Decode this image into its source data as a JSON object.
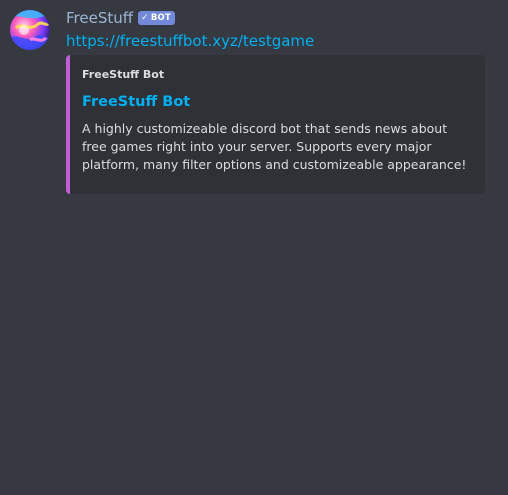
{
  "message": {
    "author": {
      "name": "FreeStuff",
      "badge": {
        "check": "✓",
        "label": "BOT",
        "color": "#7289da"
      },
      "avatar_icon": "gradient-blob-avatar"
    },
    "link_text": "https://freestuffbot.xyz/testgame",
    "embed": {
      "accent_color": "#c25ed5",
      "author": "FreeStuff Bot",
      "title": "FreeStuff Bot",
      "description": "A highly customizeable discord bot that sends news about free games right into your server. Supports every major platform, many filter options and customizeable appearance!"
    }
  },
  "theme": {
    "background": "#36393f",
    "embed_background": "#2f3136",
    "link_color": "#00b0f4",
    "username_color": "#9cb6d5"
  }
}
